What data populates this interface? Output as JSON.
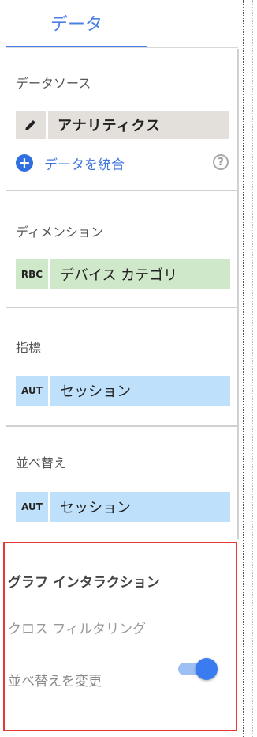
{
  "tab": {
    "label": "データ"
  },
  "data_source": {
    "title": "データソース",
    "source_name": "アナリティクス",
    "blend_label": "データを統合",
    "help_glyph": "?"
  },
  "dimension": {
    "title": "ディメンション",
    "chip": {
      "type": "RBC",
      "name": "デバイス カテゴリ"
    }
  },
  "metric": {
    "title": "指標",
    "chip": {
      "type": "AUT",
      "name": "セッション"
    }
  },
  "sort": {
    "title": "並べ替え",
    "chip": {
      "type": "AUT",
      "name": "セッション"
    }
  },
  "interaction": {
    "title": "グラフ インタラクション",
    "cross_filter_label": "クロス フィルタリング",
    "change_sort_label": "並べ替えを変更",
    "change_sort_enabled": true
  },
  "colors": {
    "accent": "#4c7fe4",
    "dimension_chip": "#cfe8c9",
    "metric_chip": "#bfe0fb",
    "highlight_border": "#e53935"
  }
}
